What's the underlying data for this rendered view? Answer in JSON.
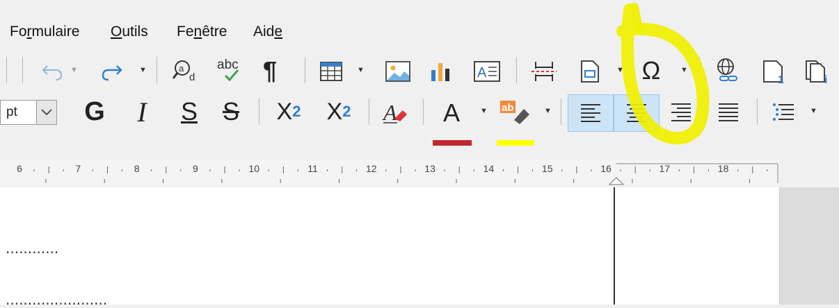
{
  "menus": [
    {
      "pre": "Fo",
      "u": "r",
      "post": "mulaire"
    },
    {
      "pre": "",
      "u": "O",
      "post": "utils"
    },
    {
      "pre": "Fe",
      "u": "n",
      "post": "être"
    },
    {
      "pre": "Aid",
      "u": "e",
      "post": ""
    }
  ],
  "toolbar2": {
    "font_size": "pt",
    "bold": "G",
    "italic": "I",
    "underline": "S",
    "strike": "S",
    "superscript_base": "X",
    "superscript_exp": "2",
    "subscript_base": "X",
    "subscript_sub": "2",
    "font_color_letter": "A"
  },
  "toolbar1": {
    "spellcheck_text": "abc",
    "find_letter": "a",
    "find_sub": "d",
    "formatting_marks": "¶",
    "special_char": "Ω"
  },
  "ruler": {
    "labels": [
      "6",
      "7",
      "8",
      "9",
      "10",
      "11",
      "12",
      "13",
      "14",
      "15",
      "16",
      "17",
      "18"
    ]
  },
  "document": {
    "line1": "............",
    "line2": "......................."
  },
  "colors": {
    "font_color_bar": "#c0282d",
    "highlight_bar": "#ffff00",
    "annotation": "#f0f000"
  }
}
